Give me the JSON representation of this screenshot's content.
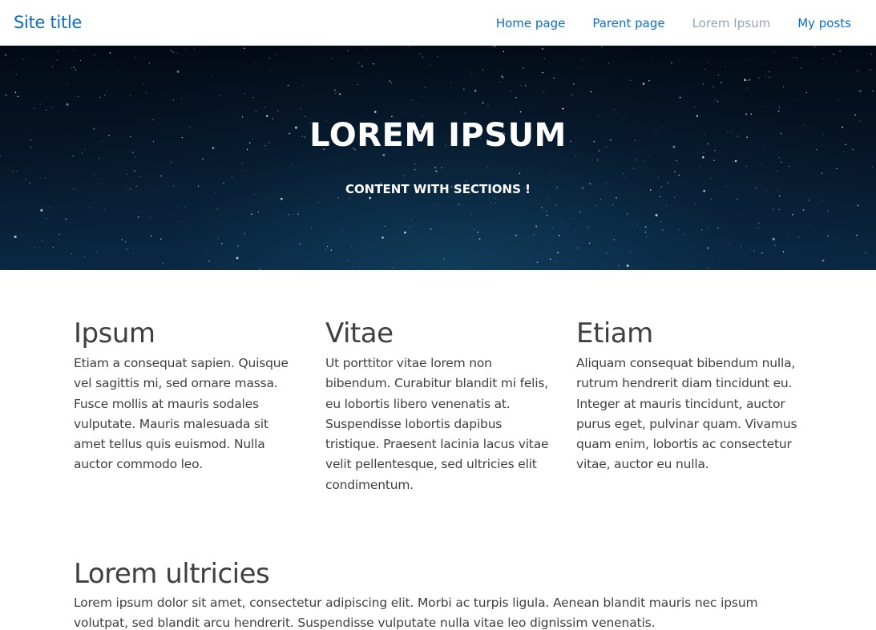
{
  "navbar": {
    "site_title": "Site title",
    "links": [
      {
        "label": "Home page"
      },
      {
        "label": "Parent page"
      },
      {
        "label": "Lorem Ipsum",
        "active": true
      },
      {
        "label": "My posts"
      }
    ]
  },
  "hero": {
    "title": "LOREM IPSUM",
    "subtitle": "CONTENT WITH SECTIONS !"
  },
  "columns": [
    {
      "heading": "Ipsum",
      "text": "Etiam a consequat sapien. Quisque vel sagittis mi, sed ornare massa. Fusce mollis at mauris sodales vulputate. Mauris malesuada sit amet tellus quis euismod. Nulla auctor commodo leo."
    },
    {
      "heading": "Vitae",
      "text": "Ut porttitor vitae lorem non bibendum. Curabitur blandit mi felis, eu lobortis libero venenatis at. Suspendisse lobortis dapibus tristique. Praesent lacinia lacus vitae velit pellentesque, sed ultricies elit condimentum."
    },
    {
      "heading": "Etiam",
      "text": "Aliquam consequat bibendum nulla, rutrum hendrerit diam tincidunt eu. Integer at mauris tincidunt, auctor purus eget, pulvinar quam. Vivamus quam enim, lobortis ac consectetur vitae, auctor eu nulla."
    }
  ],
  "section": {
    "heading": "Lorem ultricies",
    "text": "Lorem ipsum dolor sit amet, consectetur adipiscing elit. Morbi ac turpis ligula. Aenean blandit mauris nec ipsum volutpat, sed blandit arcu hendrerit. Suspendisse vulputate nulla vitae leo dignissim venenatis."
  },
  "colors": {
    "link": "#0c6ccc",
    "active_link": "#8fa3b8",
    "text": "#404040",
    "hero_text": "#ffffff"
  }
}
